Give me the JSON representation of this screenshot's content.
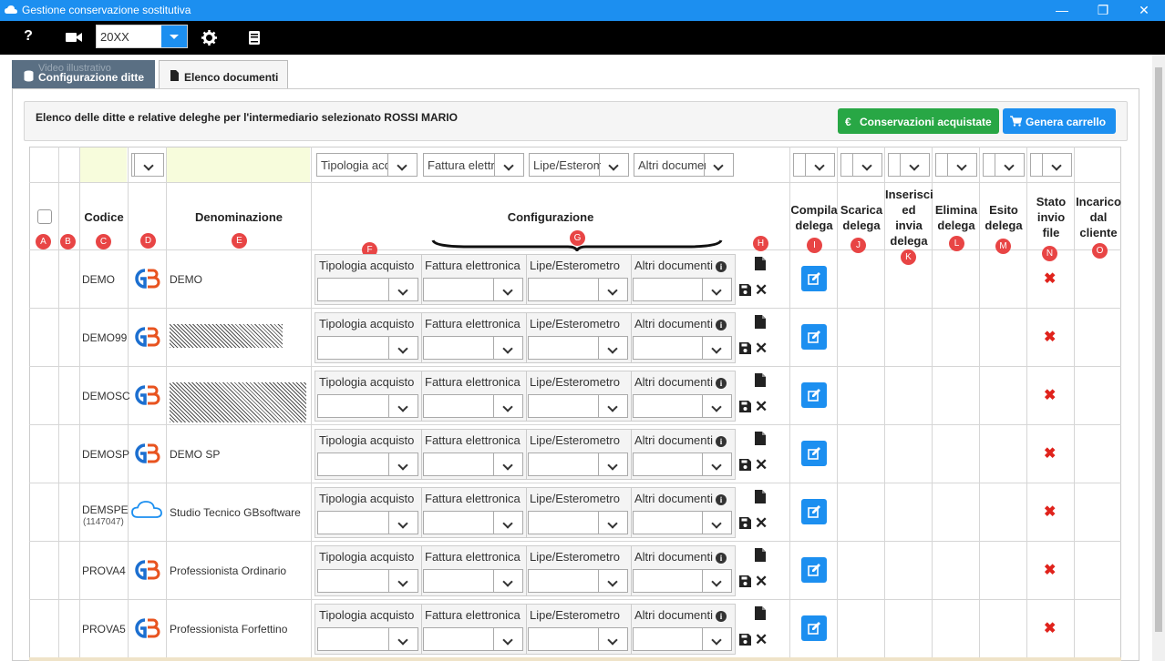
{
  "window": {
    "title": "Gestione conservazione sostitutiva"
  },
  "toolbar": {
    "year_value": "20XX",
    "icons": [
      "help-icon",
      "video-icon",
      "gear-icon",
      "book-icon"
    ]
  },
  "tabs": [
    {
      "label": "Configurazione ditte",
      "ghost": "Video illustrativo",
      "icon": "database-icon"
    },
    {
      "label": "Elenco documenti",
      "icon": "file-icon"
    }
  ],
  "info": {
    "text": "Elenco delle ditte e relative deleghe per l'intermediario selezionato ROSSI MARIO"
  },
  "actions": {
    "purchased_label": "Conservazioni acquistate",
    "purchased_icon": "euro-icon",
    "cart_label": "Genera carrello",
    "cart_icon": "cart-icon"
  },
  "filters": {
    "tipologia": "Tipologia acquisto",
    "fattura": "Fattura elettronica",
    "lipe": "Lipe/Esterometro",
    "altri": "Altri documenti"
  },
  "headers": {
    "codice": "Codice",
    "denominazione": "Denominazione",
    "configurazione": "Configurazione",
    "compila": [
      "Compila",
      "delega"
    ],
    "scarica": [
      "Scarica",
      "delega"
    ],
    "inserisci": [
      "Inserisci",
      "ed",
      "invia",
      "delega"
    ],
    "elimina": [
      "Elimina",
      "delega"
    ],
    "esito": [
      "Esito",
      "delega"
    ],
    "stato": [
      "Stato",
      "invio",
      "file"
    ],
    "incarico": [
      "Incarico",
      "dal",
      "cliente"
    ]
  },
  "badges": [
    "A",
    "B",
    "C",
    "D",
    "E",
    "F",
    "G",
    "H",
    "I",
    "J",
    "K",
    "L",
    "M",
    "N",
    "O"
  ],
  "config_labels": [
    "Tipologia acquisto",
    "Fattura elettronica",
    "Lipe/Esterometro",
    "Altri documenti"
  ],
  "rows": [
    {
      "code": "DEMO",
      "code_sub": "",
      "name": "DEMO",
      "logo": "gb-logo",
      "redacted": false
    },
    {
      "code": "DEMO99",
      "code_sub": "",
      "name": "",
      "logo": "gb-logo",
      "redacted": true
    },
    {
      "code": "DEMOSC",
      "code_sub": "",
      "name": "",
      "logo": "gb-logo",
      "redacted": true
    },
    {
      "code": "DEMOSP",
      "code_sub": "",
      "name": "DEMO SP",
      "logo": "gb-logo",
      "redacted": false
    },
    {
      "code": "DEMSPE",
      "code_sub": "(1147047)",
      "name": "Studio Tecnico GBsoftware",
      "logo": "cloud-logo",
      "redacted": false
    },
    {
      "code": "PROVA4",
      "code_sub": "",
      "name": "Professionista Ordinario",
      "logo": "gb-logo",
      "redacted": false
    },
    {
      "code": "PROVA5",
      "code_sub": "",
      "name": "Professionista Forfettino",
      "logo": "gb-logo",
      "redacted": false
    }
  ],
  "colors": {
    "accent": "#1c8ff0",
    "success": "#28a745",
    "badge": "#e84545",
    "tab_active": "#5a6f83",
    "error_x": "#e0231c"
  }
}
